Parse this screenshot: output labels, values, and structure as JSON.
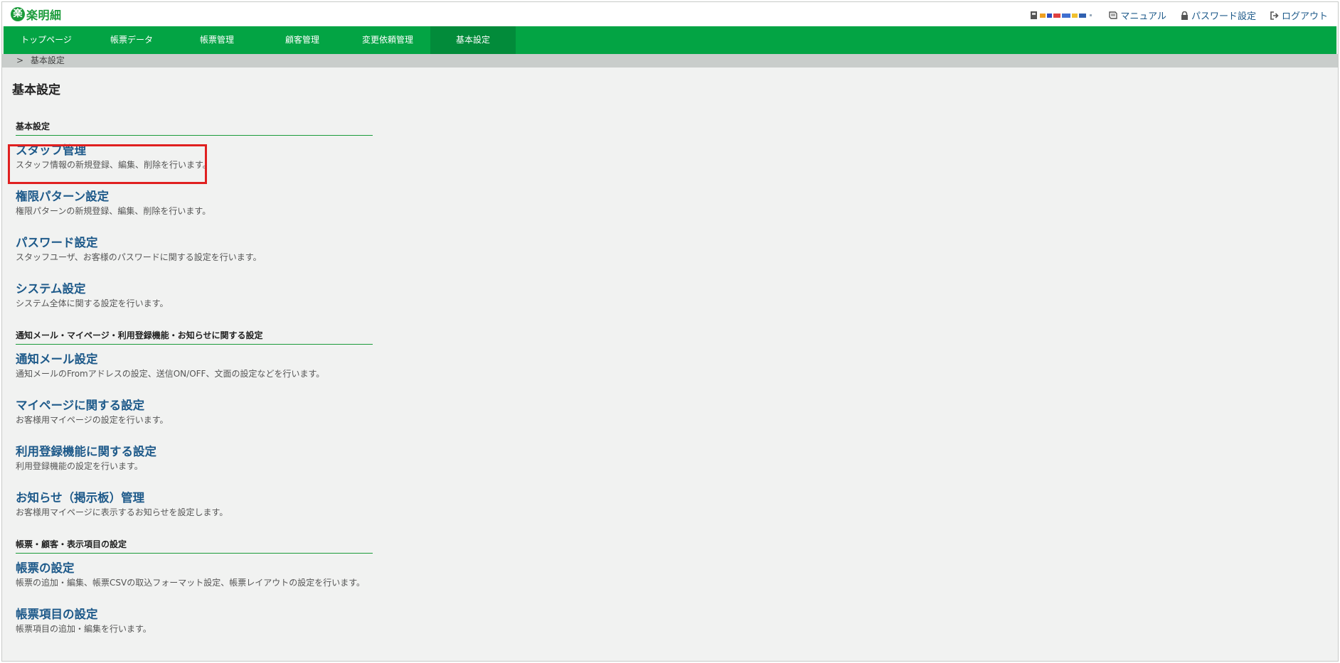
{
  "header": {
    "logo_mark": "楽",
    "logo_text": "楽明細",
    "user_name": "",
    "manual_label": "マニュアル",
    "password_label": "パスワード設定",
    "logout_label": "ログアウト"
  },
  "nav": {
    "items": [
      {
        "label": "トップページ"
      },
      {
        "label": "帳票データ"
      },
      {
        "label": "帳票管理"
      },
      {
        "label": "顧客管理"
      },
      {
        "label": "変更依頼管理"
      },
      {
        "label": "基本設定"
      }
    ],
    "active_index": 5
  },
  "breadcrumb": {
    "separator": ">",
    "current": "基本設定"
  },
  "page": {
    "title": "基本設定"
  },
  "sections": [
    {
      "heading": "基本設定",
      "entries": [
        {
          "title": "スタッフ管理",
          "desc": "スタッフ情報の新規登録、編集、削除を行います。"
        },
        {
          "title": "権限パターン設定",
          "desc": "権限パターンの新規登録、編集、削除を行います。"
        },
        {
          "title": "パスワード設定",
          "desc": "スタッフユーザ、お客様のパスワードに関する設定を行います。"
        },
        {
          "title": "システム設定",
          "desc": "システム全体に関する設定を行います。"
        }
      ]
    },
    {
      "heading": "通知メール・マイページ・利用登録機能・お知らせに関する設定",
      "entries": [
        {
          "title": "通知メール設定",
          "desc": "通知メールのFromアドレスの設定、送信ON/OFF、文面の設定などを行います。"
        },
        {
          "title": "マイページに関する設定",
          "desc": "お客様用マイページの設定を行います。"
        },
        {
          "title": "利用登録機能に関する設定",
          "desc": "利用登録機能の設定を行います。"
        },
        {
          "title": "お知らせ（掲示板）管理",
          "desc": "お客様用マイページに表示するお知らせを設定します。"
        }
      ]
    },
    {
      "heading": "帳票・顧客・表示項目の設定",
      "entries": [
        {
          "title": "帳票の設定",
          "desc": "帳票の追加・編集、帳票CSVの取込フォーマット設定、帳票レイアウトの設定を行います。"
        },
        {
          "title": "帳票項目の設定",
          "desc": "帳票項目の追加・編集を行います。"
        }
      ]
    }
  ],
  "colors": {
    "nav_green": "#03a444",
    "nav_active": "#028b3a",
    "link_blue": "#1e5a8a",
    "highlight_red": "#e02020"
  }
}
